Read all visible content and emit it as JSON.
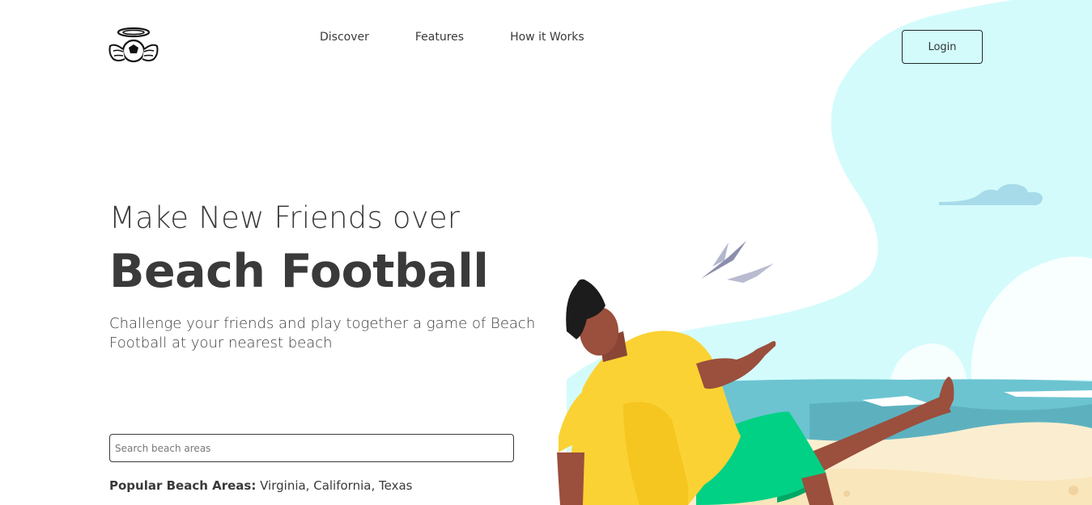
{
  "nav": {
    "items": [
      {
        "label": "Discover"
      },
      {
        "label": "Features"
      },
      {
        "label": "How it Works"
      }
    ],
    "login_label": "Login"
  },
  "hero": {
    "headline_line1": "Make New Friends over",
    "headline_line2": "Beach Football",
    "subtitle": "Challenge your friends and play together a game of Beach Football at your nearest beach"
  },
  "search": {
    "placeholder": "Search beach areas",
    "value": ""
  },
  "popular": {
    "label": "Popular Beach Areas:",
    "areas": " Virginia, California, Texas"
  },
  "colors": {
    "sky": "#d4fbfb",
    "sea": "#6cc4d1",
    "sand": "#fbeed0",
    "shirt": "#fbd233",
    "shorts": "#00d184",
    "skin": "#9b4f3d"
  },
  "icons": {
    "logo": "halo-winged-football-icon"
  }
}
